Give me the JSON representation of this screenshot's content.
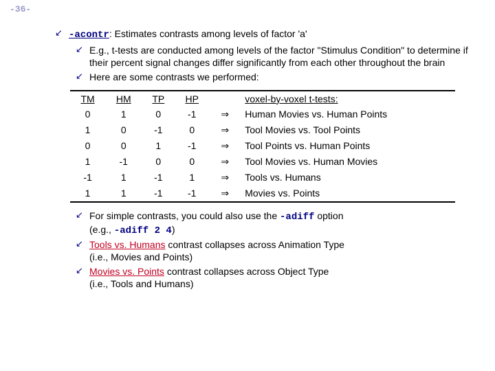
{
  "page_number": "-36-",
  "main": {
    "acontr_code": "-acontr",
    "acontr_rest": ": Estimates contrasts among levels of factor 'a'",
    "sub1": "E.g., t-tests are conducted among levels of the factor \"Stimulus Condition\" to determine if their percent signal changes differ significantly from each other throughout the brain",
    "sub2": "Here are some contrasts we performed:"
  },
  "table": {
    "headers": {
      "tm": "TM",
      "hm": "HM",
      "tp": "TP",
      "hp": "HP",
      "desc": "voxel-by-voxel t-tests:"
    },
    "rows": [
      {
        "tm": "0",
        "hm": "1",
        "tp": "0",
        "hp": "-1",
        "desc": "Human Movies vs. Human Points"
      },
      {
        "tm": "1",
        "hm": "0",
        "tp": "-1",
        "hp": "0",
        "desc": "Tool Movies vs. Tool Points"
      },
      {
        "tm": "0",
        "hm": "0",
        "tp": "1",
        "hp": "-1",
        "desc": "Tool Points vs. Human Points"
      },
      {
        "tm": "1",
        "hm": "-1",
        "tp": "0",
        "hp": "0",
        "desc": "Tool Movies vs. Human Movies"
      },
      {
        "tm": "-1",
        "hm": "1",
        "tp": "-1",
        "hp": "1",
        "desc": "Tools vs. Humans"
      },
      {
        "tm": "1",
        "hm": "1",
        "tp": "-1",
        "hp": "-1",
        "desc": "Movies vs. Points"
      }
    ],
    "arrow_glyph": "⇒"
  },
  "after": {
    "line1_a": "For simple contrasts, you could also use the ",
    "line1_code": "-adiff",
    "line1_b": " option",
    "line1_c_pre": "(e.g., ",
    "line1_c_code": "-adiff 2 4",
    "line1_c_post": ")",
    "line2_a": " Tools vs. Humans",
    "line2_b": " contrast collapses across Animation Type",
    "line2_c": "(i.e., Movies and Points)",
    "line3_a": " Movies vs. Points",
    "line3_b": " contrast collapses across Object Type",
    "line3_c": "(i.e., Tools and Humans)"
  },
  "arrow_glyph": "↙"
}
